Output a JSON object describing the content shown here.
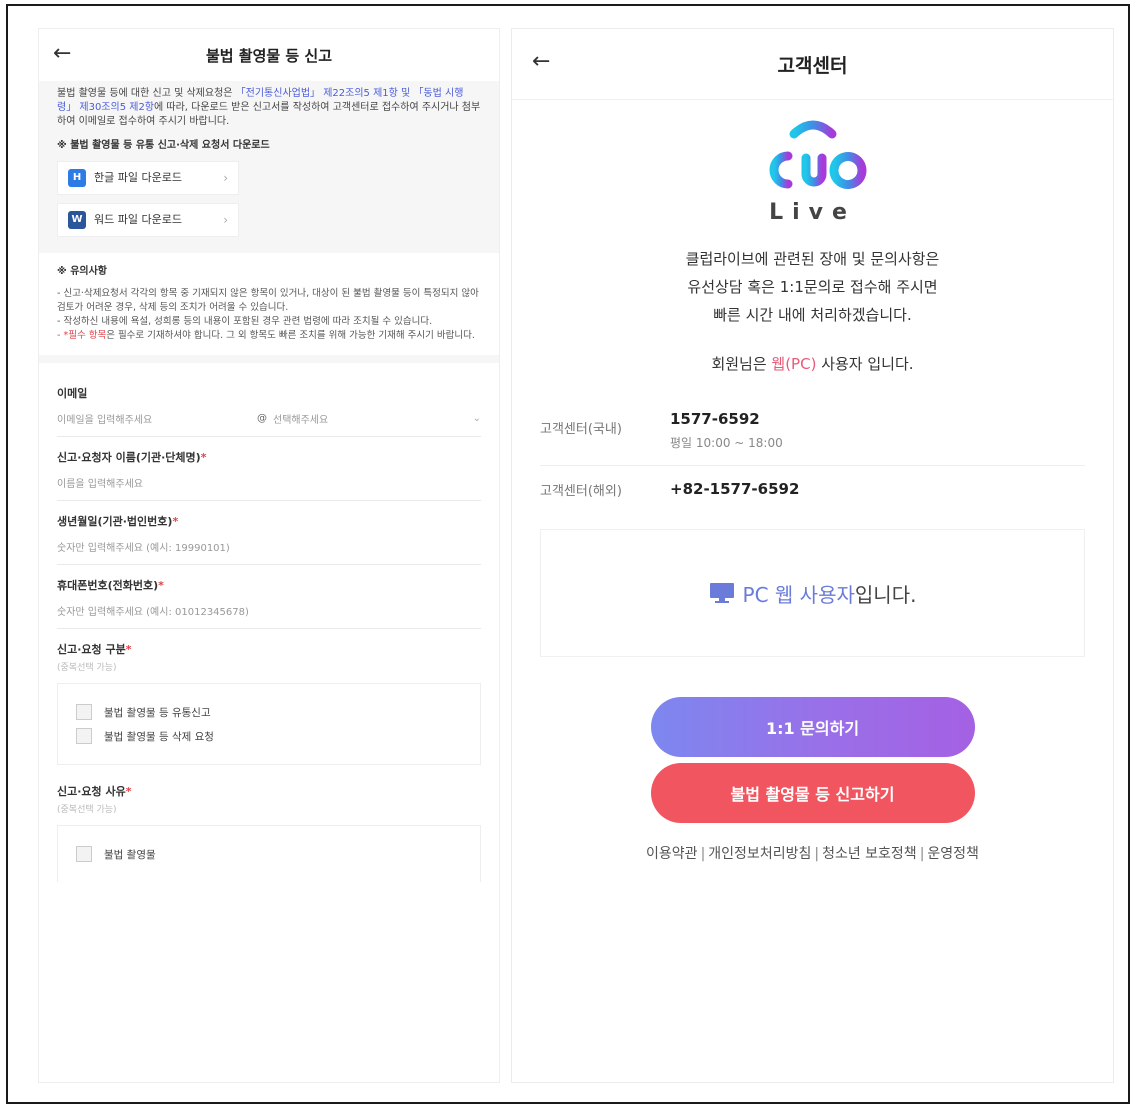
{
  "left": {
    "title": "불법 촬영물 등 신고",
    "notice": {
      "text1": "불법 촬영물 등에 대한 신고 및 삭제요청은 ",
      "link1": "「전기통신사업법」 제22조의5 제1항 및",
      "link2": "「동법 시행령」 제30조의5 제2항",
      "text2": "에 따라, 다운로드 받은 신고서를 작성하여 고객센터로 접수하여 주시거나 첨부하여 이메일로 접수하여 주시기 바랍니다.",
      "download_heading": "※ 불법 촬영물 등 유통 신고·삭제 요청서 다운로드",
      "hwp_label": "한글 파일 다운로드",
      "word_label": "워드 파일 다운로드"
    },
    "caution": {
      "heading": "※ 유의사항",
      "line1": "- 신고·삭제요청서 각각의 항목 중 기재되지 않은 항목이 있거나, 대상이 된 불법 촬영물 등이 특정되지 않아 검토가 어려운 경우, 삭제 등의 조치가 어려울 수 있습니다.",
      "line2": "- 작성하신 내용에 욕설, 성희롱 등의 내용이 포함된 경우 관련 법령에 따라 조치될 수 있습니다.",
      "line3_req": "- *필수 항목",
      "line3_rest": "은 필수로 기재하셔야 합니다. 그 외 항목도 빠른 조치를 위해 가능한 기재해 주시기 바랍니다."
    },
    "form": {
      "email_label": "이메일",
      "email_placeholder": "이메일을 입력해주세요",
      "email_at": "@",
      "email_domain_placeholder": "선택해주세요",
      "name_label": "신고·요청자 이름(기관·단체명)",
      "name_placeholder": "이름을 입력해주세요",
      "birth_label": "생년월일(기관·법인번호)",
      "birth_placeholder": "숫자만 입력해주세요 (예시: 19990101)",
      "phone_label": "휴대폰번호(전화번호)",
      "phone_placeholder": "숫자만 입력해주세요 (예시: 01012345678)",
      "type_label": "신고·요청 구분",
      "type_hint": "(중복선택 가능)",
      "type_opt1": "불법 촬영물 등 유통신고",
      "type_opt2": "불법 촬영물 등 삭제 요청",
      "reason_label": "신고·요청 사유",
      "reason_hint": "(중복선택 가능)",
      "reason_opt1": "불법 촬영물",
      "required_mark": "*"
    }
  },
  "right": {
    "title": "고객센터",
    "logo_word": "Live",
    "desc1": "클럽라이브에 관련된 장애 및 문의사항은",
    "desc2": "유선상담 혹은 1:1문의로 접수해 주시면",
    "desc3": "빠른 시간 내에 처리하겠습니다.",
    "user_pre": "회원님은 ",
    "user_accent": "웹(PC)",
    "user_post": " 사용자 입니다.",
    "cs_domestic_label": "고객센터(국내)",
    "cs_domestic_number": "1577-6592",
    "cs_domestic_hours": "평일 10:00 ~ 18:00",
    "cs_overseas_label": "고객센터(해외)",
    "cs_overseas_number": "+82-1577-6592",
    "pc_user_accent": "PC 웹 사용자",
    "pc_user_rest": "입니다.",
    "inquiry_button": "1:1 문의하기",
    "report_button": "불법 촬영물 등 신고하기",
    "footer": [
      "이용약관",
      "개인정보처리방침",
      "청소년 보호정책",
      "운영정책"
    ],
    "footer_sep": "|"
  },
  "colors": {
    "accent_pink": "#e65a7a",
    "accent_purple": "#9a6fe8",
    "report_red": "#f1555f",
    "link_blue": "#4a5cd8"
  },
  "icons": [
    "back-arrow-icon",
    "hwp-file-icon",
    "word-file-icon",
    "chevron-right-icon",
    "chevron-down-icon",
    "monitor-icon",
    "club-live-logo"
  ]
}
